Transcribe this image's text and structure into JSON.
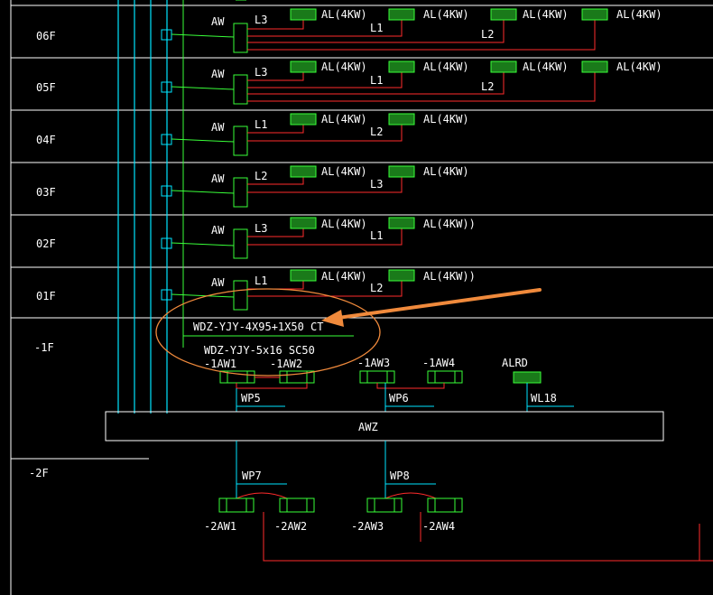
{
  "floors": [
    {
      "label": "06F",
      "panel": "AW",
      "loads": [
        {
          "circuit": "L3",
          "label": "AL(4KW)"
        },
        {
          "circuit": "L1",
          "label": "AL(4KW)"
        },
        {
          "circuit": "L2",
          "label": "AL(4KW)"
        },
        {
          "circuit": "",
          "label": "AL(4KW)"
        }
      ]
    },
    {
      "label": "05F",
      "panel": "AW",
      "loads": [
        {
          "circuit": "L3",
          "label": "AL(4KW)"
        },
        {
          "circuit": "L1",
          "label": "AL(4KW)"
        },
        {
          "circuit": "L2",
          "label": "AL(4KW)"
        },
        {
          "circuit": "",
          "label": "AL(4KW)"
        }
      ]
    },
    {
      "label": "04F",
      "panel": "AW",
      "loads": [
        {
          "circuit": "L1",
          "label": "AL(4KW)"
        },
        {
          "circuit": "L2",
          "label": "AL(4KW)"
        }
      ]
    },
    {
      "label": "03F",
      "panel": "AW",
      "loads": [
        {
          "circuit": "L2",
          "label": "AL(4KW)"
        },
        {
          "circuit": "L3",
          "label": "AL(4KW)"
        }
      ]
    },
    {
      "label": "02F",
      "panel": "AW",
      "loads": [
        {
          "circuit": "L3",
          "label": "AL(4KW)"
        },
        {
          "circuit": "L1",
          "label": "AL(4KW))"
        }
      ]
    },
    {
      "label": "01F",
      "panel": "AW",
      "loads": [
        {
          "circuit": "L1",
          "label": "AL(4KW)"
        },
        {
          "circuit": "L2",
          "label": "AL(4KW))"
        }
      ]
    }
  ],
  "basement1": {
    "label": "-1F",
    "feeder_cable": "WDZ-YJY-4X95+1X50 CT",
    "branch_cable": "WDZ-YJY-5x16 SC50",
    "boxes": [
      "-1AW1",
      "-1AW2",
      "-1AW3",
      "-1AW4",
      "ALRD"
    ],
    "lines": [
      "WP5",
      "WP6",
      "WL18"
    ]
  },
  "main_panel": "AWZ",
  "basement2": {
    "label": "-2F",
    "lines": [
      "WP7",
      "WP8"
    ],
    "boxes": [
      "-2AW1",
      "-2AW2",
      "-2AW3",
      "-2AW4"
    ]
  },
  "colors": {
    "background": "#000000",
    "grid": "#ffffff",
    "riser": "#00e5ff",
    "equipment": "#39ff39",
    "feeder": "#ff2b2b",
    "annotation": "#f08a3c",
    "text": "#ffffff"
  }
}
